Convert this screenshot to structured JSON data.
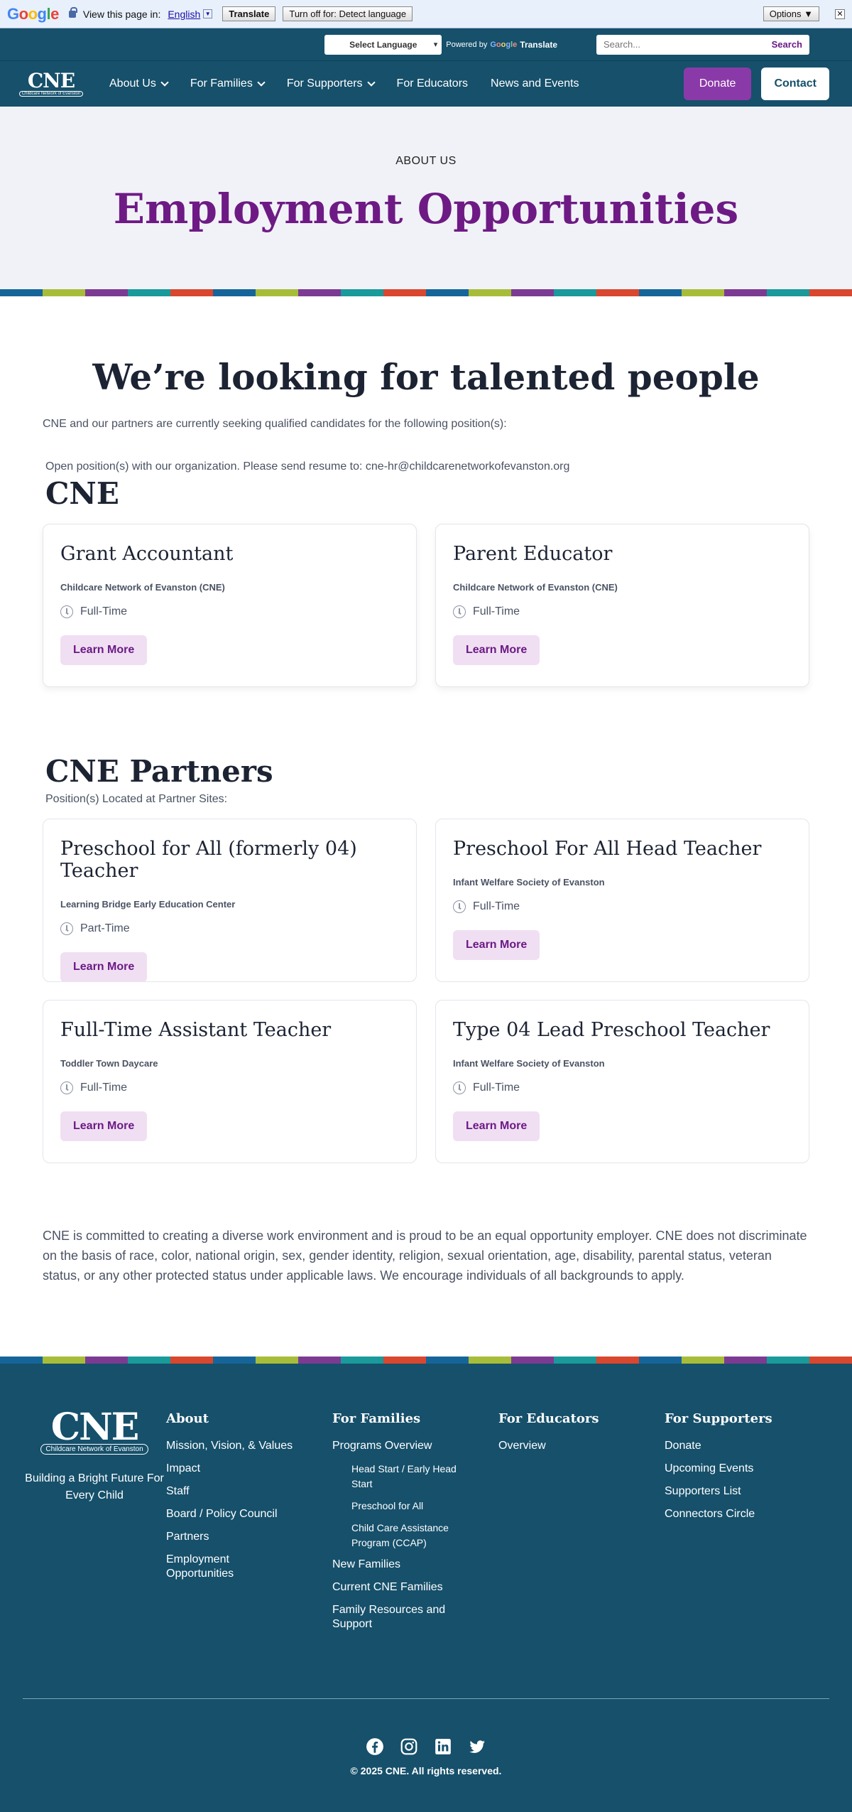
{
  "translate_bar": {
    "logo": "Google",
    "prompt": "View this page in:",
    "language": "English",
    "translate_button": "Translate",
    "turn_off_button": "Turn off for: Detect language",
    "options_button": "Options ▼",
    "close": "✕"
  },
  "utility": {
    "select_language": "Select Language",
    "powered_by": "Powered by",
    "google": "Google",
    "translate": "Translate",
    "search_placeholder": "Search...",
    "search_button": "Search"
  },
  "nav": {
    "logo_mark": "CNE",
    "logo_sub": "Childcare Network of Evanston",
    "items": [
      {
        "label": "About Us"
      },
      {
        "label": "For Families"
      },
      {
        "label": "For Supporters"
      },
      {
        "label": "For Educators"
      },
      {
        "label": "News and Events"
      }
    ],
    "donate": "Donate",
    "contact": "Contact"
  },
  "hero": {
    "eyebrow": "ABOUT US",
    "title": "Employment Opportunities"
  },
  "stripe_colors": [
    "#16659a",
    "#a7bd3a",
    "#7b3b93",
    "#1a9a9a",
    "#d9472f"
  ],
  "main": {
    "heading": "We’re looking for talented people",
    "intro": "CNE and our partners are currently seeking qualified candidates for the following position(s):",
    "open_note": "Open position(s) with our organization. Please send resume to: cne-hr@childcarenetworkofevanston.org",
    "cne_title": "CNE",
    "cne_jobs": [
      {
        "title": "Grant Accountant",
        "org": "Childcare Network of Evanston (CNE)",
        "type": "Full-Time",
        "cta": "Learn More"
      },
      {
        "title": "Parent Educator",
        "org": "Childcare Network of Evanston (CNE)",
        "type": "Full-Time",
        "cta": "Learn More"
      }
    ],
    "partners_title": "CNE Partners",
    "partners_sub": "Position(s) Located at Partner Sites:",
    "partner_jobs": [
      {
        "title": "Preschool for All (formerly 04) Teacher",
        "org": "Learning Bridge Early Education Center",
        "type": "Part-Time",
        "cta": "Learn More"
      },
      {
        "title": "Preschool For All Head Teacher",
        "org": "Infant Welfare Society of Evanston",
        "type": "Full-Time",
        "cta": "Learn More"
      },
      {
        "title": "Full-Time Assistant Teacher",
        "org": "Toddler Town Daycare",
        "type": "Full-Time",
        "cta": "Learn More"
      },
      {
        "title": "Type 04 Lead Preschool Teacher",
        "org": "Infant Welfare Society of Evanston",
        "type": "Full-Time",
        "cta": "Learn More"
      }
    ],
    "eeo": "CNE is committed to creating a diverse work environment and is proud to be an equal opportunity employer. CNE does not discriminate on the basis of race, color, national origin, sex, gender identity, religion, sexual orientation, age, disability, parental status, veteran status, or any other protected status under applicable laws. We encourage individuals of all backgrounds to apply."
  },
  "footer": {
    "logo_mark": "CNE",
    "logo_sub": "Childcare Network of Evanston",
    "tagline": "Building a Bright Future For Every Child",
    "about": {
      "title": "About",
      "links": [
        "Mission, Vision, & Values",
        "Impact",
        "Staff",
        "Board / Policy Council",
        "Partners",
        "Employment Opportunities"
      ]
    },
    "families": {
      "title": "For Families",
      "overview": "Programs Overview",
      "sub_links": [
        "Head Start / Early Head Start",
        "Preschool for All",
        "Child Care Assistance Program (CCAP)"
      ],
      "links": [
        "New Families",
        "Current CNE Families",
        "Family Resources and Support"
      ]
    },
    "educators": {
      "title": "For Educators",
      "links": [
        "Overview"
      ]
    },
    "supporters": {
      "title": "For Supporters",
      "links": [
        "Donate",
        "Upcoming Events",
        "Supporters List",
        "Connectors Circle"
      ]
    },
    "social": [
      "facebook-icon",
      "instagram-icon",
      "linkedin-icon",
      "twitter-icon"
    ],
    "copyright": "© 2025 CNE. All rights reserved."
  }
}
